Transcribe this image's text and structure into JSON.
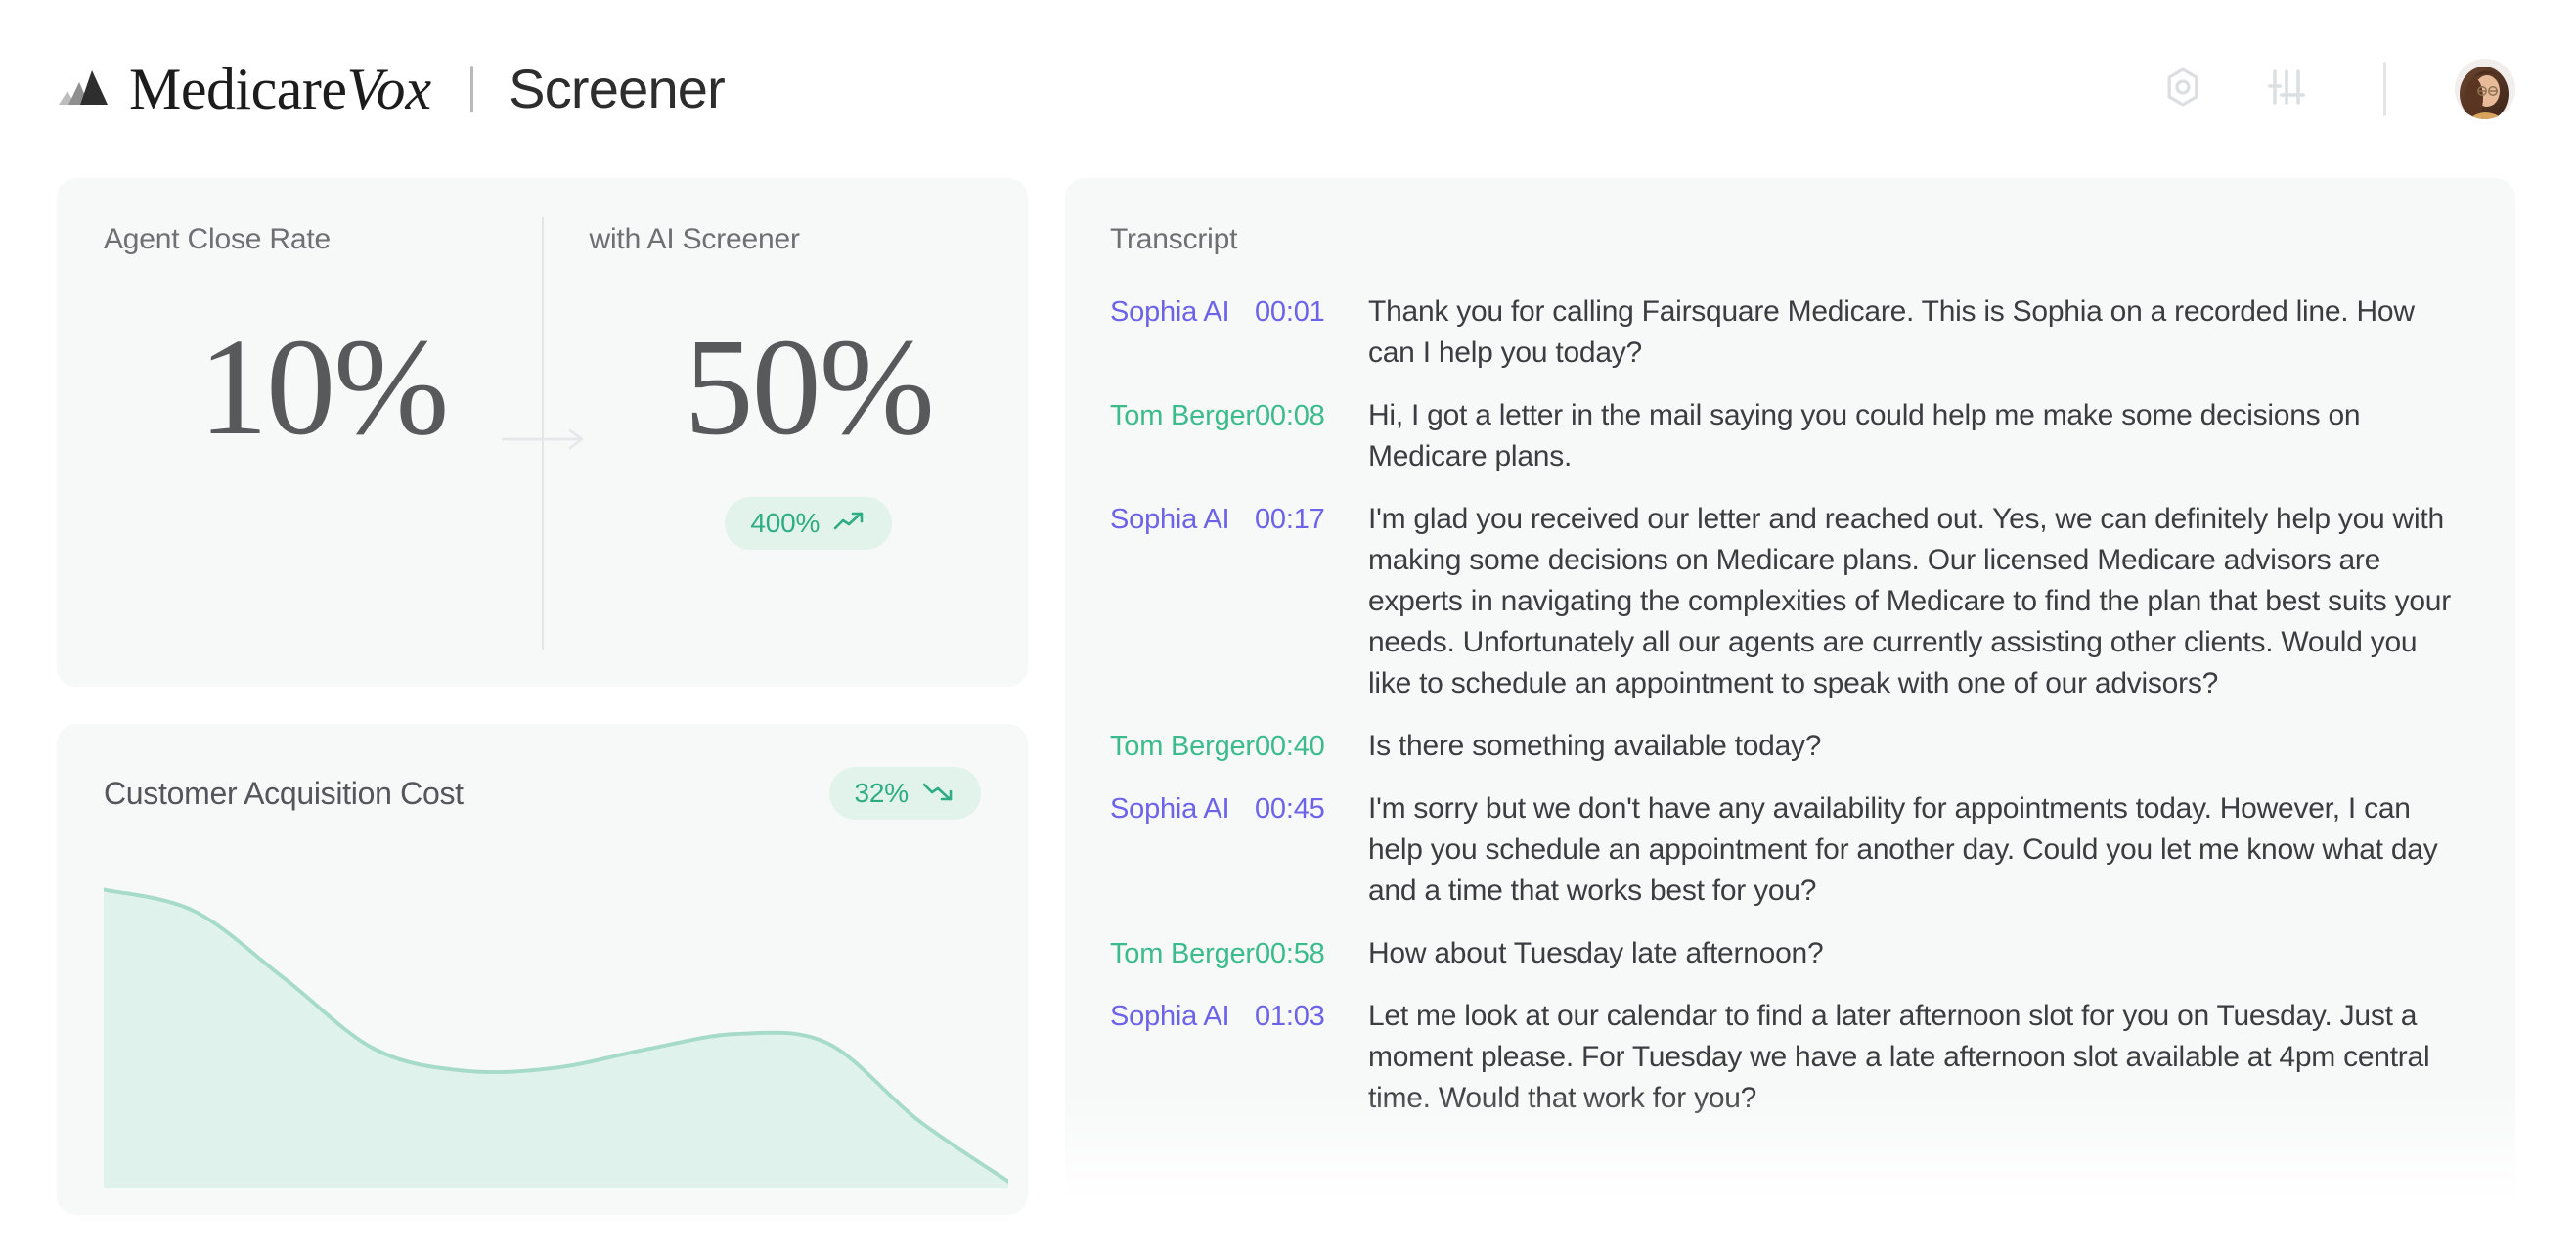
{
  "header": {
    "brand_primary": "Medicare",
    "brand_accent": "Vox",
    "brand_mark_icon": "mountain-peaks-icon",
    "separator": "|",
    "page_title": "Screener",
    "tools": [
      {
        "icon": "hexagon-target-icon",
        "name": "settings-hex-button"
      },
      {
        "icon": "sliders-icon",
        "name": "filters-sliders-button"
      }
    ],
    "avatar_alt": "user-avatar"
  },
  "stats": {
    "left_label": "Agent Close Rate",
    "left_value": "10%",
    "right_label": "with AI Screener",
    "right_value": "50%",
    "arrow_icon": "arrow-right-icon",
    "badge": {
      "value": "400%",
      "trend": "up",
      "icon": "trending-up-icon"
    }
  },
  "cac": {
    "title": "Customer Acquisition Cost",
    "badge": {
      "value": "32%",
      "trend": "down",
      "icon": "trending-down-icon"
    }
  },
  "chart_data": {
    "type": "area",
    "title": "Customer Acquisition Cost",
    "xlabel": "",
    "ylabel": "",
    "grid": false,
    "legend": null,
    "line_color": "#a6dbc9",
    "fill_color": "#e0f2ec",
    "ylim": [
      0,
      100
    ],
    "x": [
      0,
      10,
      20,
      30,
      40,
      50,
      60,
      70,
      80,
      90,
      100
    ],
    "values": [
      97,
      90,
      68,
      45,
      38,
      39,
      45,
      50,
      47,
      22,
      2
    ]
  },
  "transcript": {
    "title": "Transcript",
    "speaker_colors": {
      "ai": "#6c63e8",
      "user": "#3cbc8d"
    },
    "messages": [
      {
        "speaker": "Sophia AI",
        "role": "ai",
        "time": "00:01",
        "text": "Thank you for calling Fairsquare Medicare. This is Sophia on a recorded line. How can I help you today?"
      },
      {
        "speaker": "Tom Berger",
        "role": "user",
        "time": "00:08",
        "text": "Hi, I got a letter in the mail saying you could help me make some decisions on Medicare plans."
      },
      {
        "speaker": "Sophia AI",
        "role": "ai",
        "time": "00:17",
        "text": "I'm glad you received our letter and reached out. Yes, we can definitely help you with making some decisions on Medicare plans. Our licensed Medicare advisors are experts in navigating the complexities of Medicare to find the plan that best suits your needs. Unfortunately all our agents are currently assisting other clients. Would you like to schedule an appointment to speak with one of our advisors?"
      },
      {
        "speaker": "Tom Berger",
        "role": "user",
        "time": "00:40",
        "text": "Is there something available today?"
      },
      {
        "speaker": "Sophia AI",
        "role": "ai",
        "time": "00:45",
        "text": "I'm sorry but we don't have any availability for appointments today. However, I can help you schedule an appointment for another day. Could you let me know what day and a time that works best for you?"
      },
      {
        "speaker": "Tom Berger",
        "role": "user",
        "time": "00:58",
        "text": "How about Tuesday late afternoon?"
      },
      {
        "speaker": "Sophia AI",
        "role": "ai",
        "time": "01:03",
        "text": "Let me look at our calendar to find a later afternoon slot for you on Tuesday. Just a moment please. For Tuesday we have a late afternoon slot available at 4pm central time. Would that work for you?"
      }
    ]
  }
}
